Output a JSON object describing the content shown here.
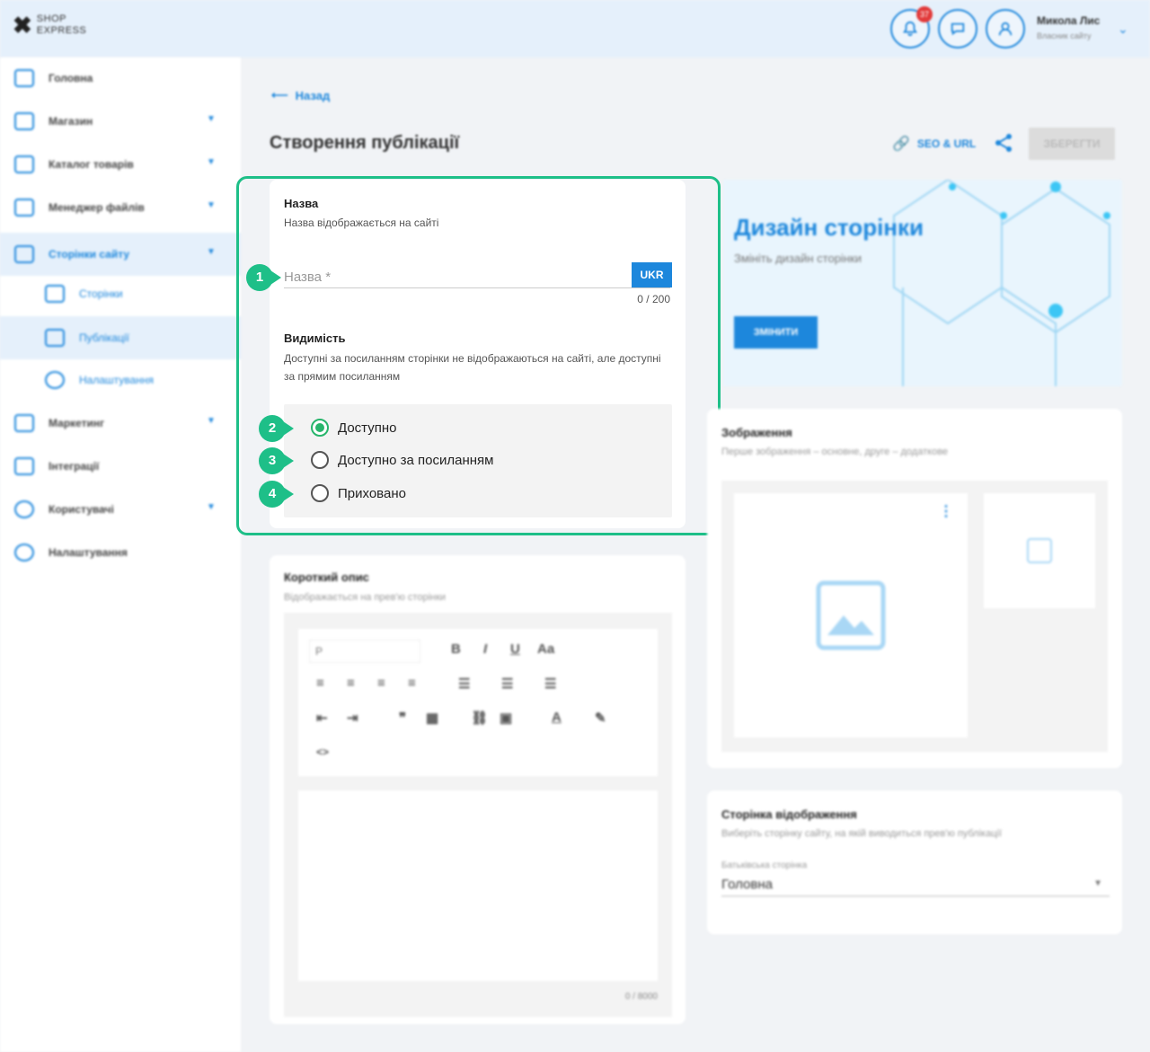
{
  "header": {
    "logo_line1": "SHOP",
    "logo_line2": "EXPRESS",
    "notifications_count": "37",
    "user_name": "Микола Лис",
    "user_role": "Власник сайту"
  },
  "sidebar": {
    "items": [
      {
        "label": "Головна",
        "icon": "home-icon"
      },
      {
        "label": "Магазин",
        "icon": "cart-icon"
      },
      {
        "label": "Каталог товарів",
        "icon": "book-icon"
      },
      {
        "label": "Менеджер файлів",
        "icon": "folder-icon"
      },
      {
        "label": "Сторінки сайту",
        "icon": "pages-icon"
      },
      {
        "label": "Сторінки",
        "icon": "page-icon"
      },
      {
        "label": "Публікації",
        "icon": "publication-icon"
      },
      {
        "label": "Налаштування",
        "icon": "gear-icon"
      },
      {
        "label": "Маркетинг",
        "icon": "tag-icon"
      },
      {
        "label": "Інтеграції",
        "icon": "megaphone-icon"
      },
      {
        "label": "Користувачі",
        "icon": "user-icon"
      },
      {
        "label": "Налаштування",
        "icon": "gear-icon"
      }
    ]
  },
  "page": {
    "back_label": "Назад",
    "title": "Створення публікації",
    "seo_label": "SEO & URL",
    "save_label": "ЗБЕРЕГТИ"
  },
  "name_section": {
    "heading": "Назва",
    "subtitle": "Назва відображається на сайті",
    "placeholder": "Назва *",
    "lang": "UKR",
    "counter": "0 / 200"
  },
  "visibility": {
    "heading": "Видимість",
    "subtitle": "Доступні за посиланням сторінки не відображаються на сайті, але доступні за прямим посиланням",
    "options": [
      "Доступно",
      "Доступно за посиланням",
      "Приховано"
    ],
    "selected": "Доступно"
  },
  "markers": [
    "1",
    "2",
    "3",
    "4"
  ],
  "short_desc": {
    "heading": "Короткий опис",
    "subtitle": "Відображається на прев'ю сторінки",
    "format_select": "P",
    "counter": "0 / 8000"
  },
  "design": {
    "heading": "Дизайн сторінки",
    "subtitle": "Змініть дизайн сторінки",
    "button": "ЗМІНИТИ"
  },
  "images": {
    "heading": "Зображення",
    "subtitle": "Перше зображення – основне, друге – додаткове"
  },
  "display_page": {
    "heading": "Сторінка відображення",
    "subtitle": "Виберіть сторінку сайту, на якій виводиться прев'ю публікації",
    "field_label": "Батьківська сторінка",
    "value": "Головна"
  },
  "colors": {
    "accent": "#1d87dc",
    "highlight": "#1ebf88",
    "radio_on": "#27b56b"
  }
}
